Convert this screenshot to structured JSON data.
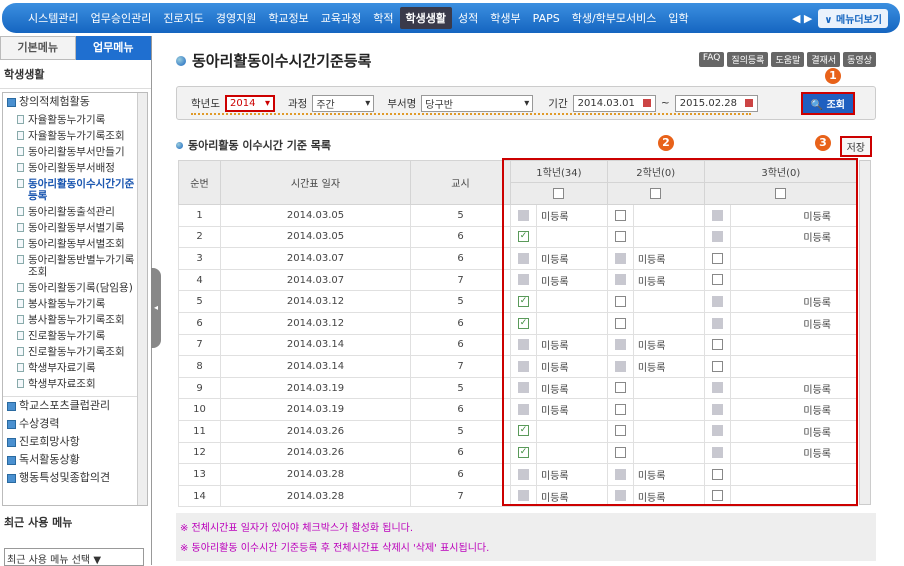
{
  "topnav": {
    "items": [
      "시스템관리",
      "업무승인관리",
      "진로지도",
      "경영지원",
      "학교정보",
      "교육과정",
      "학적",
      "학생생활",
      "성적",
      "학생부",
      "PAPS",
      "학생/학부모서비스",
      "입학"
    ],
    "active_index": 7,
    "arrows": "◀ ▶",
    "menu_view": "∨ 메뉴더보기"
  },
  "sidebar": {
    "tabs": [
      "기본메뉴",
      "업무메뉴"
    ],
    "active_tab": 1,
    "section_title": "학생생활",
    "group": "창의적체험활동",
    "items": [
      "자율활동누가기록",
      "자율활동누가기록조회",
      "동아리활동부서만들기",
      "동아리활동부서배정",
      "동아리활동이수시간기준등록",
      "동아리활동출석관리",
      "동아리활동부서별기록",
      "동아리활동부서별조회",
      "동아리활동반별누가기록조회",
      "동아리활동기록(담임용)",
      "봉사활동누가기록",
      "봉사활동누가기록조회",
      "진로활동누가기록",
      "진로활동누가기록조회",
      "학생부자료기록",
      "학생부자료조회"
    ],
    "active_item": 4,
    "groups": [
      "학교스포츠클럽관리",
      "수상경력",
      "진로희망사항",
      "독서활동상황",
      "행동특성및종합의견"
    ],
    "recent_title": "최근 사용 메뉴",
    "recent_select": "최근 사용 메뉴 선택"
  },
  "main": {
    "title": "동아리활동이수시간기준등록",
    "help_buttons": [
      "FAQ",
      "질의등록",
      "도움말",
      "결재서",
      "동영상"
    ],
    "filter": {
      "year_label": "학년도",
      "year": "2014",
      "course_label": "과정",
      "course": "주간",
      "dept_label": "부서명",
      "dept": "당구반",
      "period_label": "기간",
      "from": "2014.03.01",
      "tilde": "~",
      "to": "2015.02.28",
      "search": "조회"
    },
    "badges": [
      "1",
      "2",
      "3"
    ],
    "list_title": "동아리활동 이수시간 기준 목록",
    "save": "저장",
    "columns": [
      "순번",
      "시간표 일자",
      "교시",
      "1학년(34)",
      "2학년(0)",
      "3학년(0)"
    ],
    "unregistered": "미등록",
    "rows": [
      [
        "1",
        "2014.03.05",
        "5",
        "dis",
        "off",
        "dis"
      ],
      [
        "2",
        "2014.03.05",
        "6",
        "chk",
        "off",
        "dis"
      ],
      [
        "3",
        "2014.03.07",
        "6",
        "dis",
        "dis",
        "off"
      ],
      [
        "4",
        "2014.03.07",
        "7",
        "dis",
        "dis",
        "off"
      ],
      [
        "5",
        "2014.03.12",
        "5",
        "chk",
        "off",
        "dis"
      ],
      [
        "6",
        "2014.03.12",
        "6",
        "chk",
        "off",
        "dis"
      ],
      [
        "7",
        "2014.03.14",
        "6",
        "dis",
        "dis",
        "off"
      ],
      [
        "8",
        "2014.03.14",
        "7",
        "dis",
        "dis",
        "off"
      ],
      [
        "9",
        "2014.03.19",
        "5",
        "dis",
        "off",
        "dis"
      ],
      [
        "10",
        "2014.03.19",
        "6",
        "dis",
        "off",
        "dis"
      ],
      [
        "11",
        "2014.03.26",
        "5",
        "chk",
        "off",
        "dis"
      ],
      [
        "12",
        "2014.03.26",
        "6",
        "chk",
        "off",
        "dis"
      ],
      [
        "13",
        "2014.03.28",
        "6",
        "dis",
        "dis",
        "off"
      ],
      [
        "14",
        "2014.03.28",
        "7",
        "dis",
        "dis",
        "off"
      ]
    ],
    "notes": [
      "※ 전체시간표 일자가 있어야 체크박스가 활성화 됩니다.",
      "※ 동아리활동 이수시간 기준등록 후 전체시간표 삭제시 '삭제' 표시됩니다."
    ]
  }
}
